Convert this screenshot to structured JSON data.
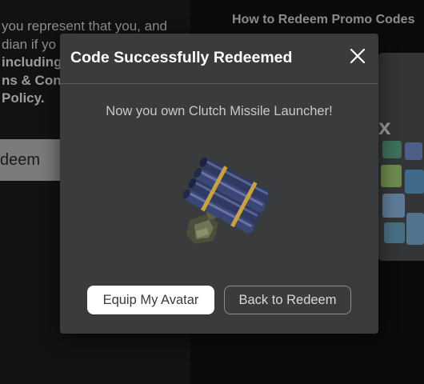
{
  "background": {
    "terms_lines": [
      "you represent that you, and",
      "dian if yo",
      "including",
      "ns & Conc",
      " Policy."
    ],
    "redeem_button_label": "deem",
    "side_title": "How to Redeem Promo Codes",
    "promo_card_glyph": "x"
  },
  "modal": {
    "title": "Code Successfully Redeemed",
    "close_icon": "close-icon",
    "message": "Now you own Clutch Missile Launcher!",
    "item_image": "missile-launcher-image",
    "primary_button": "Equip My Avatar",
    "secondary_button": "Back to Redeem"
  },
  "colors": {
    "modal_bg": "#393b3d",
    "page_bg": "#121213",
    "primary_button_bg": "#ffffff",
    "secondary_button_border": "#8b8c8e"
  }
}
